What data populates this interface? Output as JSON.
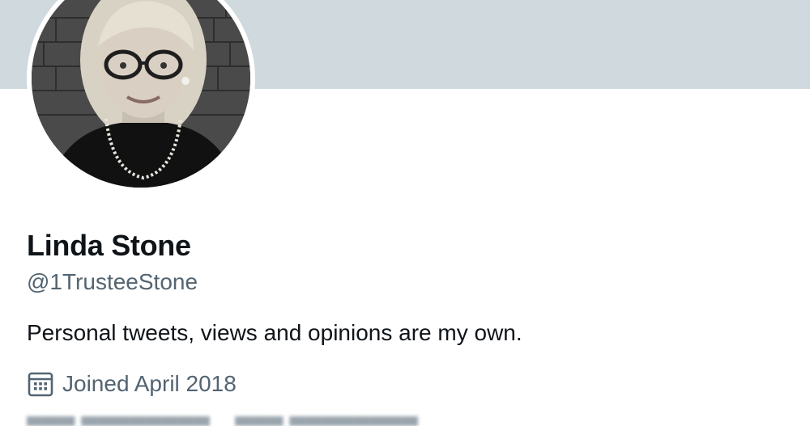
{
  "profile": {
    "display_name": "Linda Stone",
    "handle": "@1TrusteeStone",
    "bio": "Personal tweets, views and opinions are my own.",
    "joined_text": "Joined April 2018",
    "avatar": "profile-photo",
    "calendar_icon": "calendar-icon"
  },
  "colors": {
    "banner": "#cfd9de",
    "text_primary": "#0f1419",
    "text_secondary": "#536471"
  }
}
